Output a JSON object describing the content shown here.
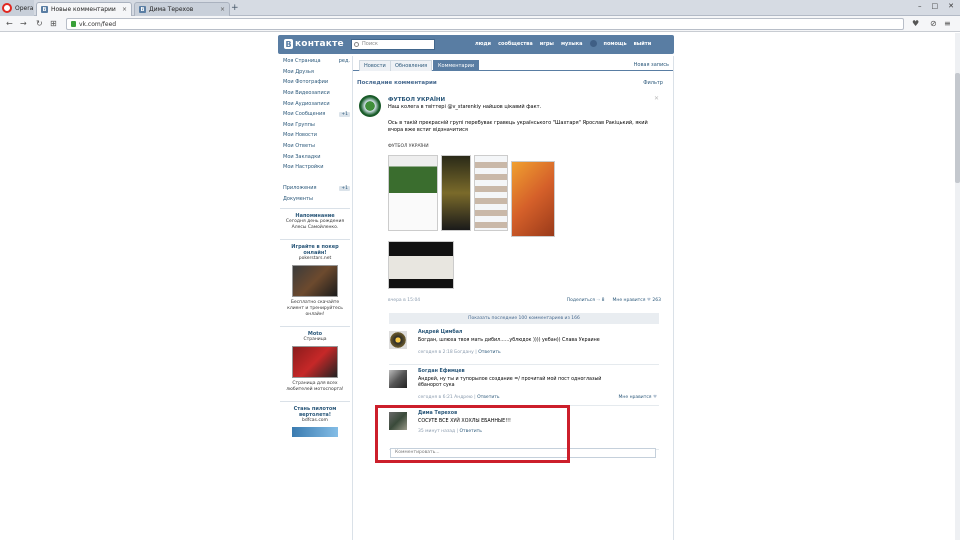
{
  "browser": {
    "menu_label": "Opera",
    "tabs": [
      {
        "title": "Новые комментарии",
        "favicon": "B",
        "active": true
      },
      {
        "title": "Дима Терехов",
        "favicon": "B",
        "active": false
      }
    ],
    "new_tab": "+",
    "address": "vk.com/feed"
  },
  "vk": {
    "logo_letter": "B",
    "logo_text": "контакте",
    "search_placeholder": "Поиск",
    "top_nav": [
      "люди",
      "сообщества",
      "игры",
      "музыка",
      "помощь",
      "выйти"
    ]
  },
  "left_menu": {
    "items": [
      {
        "label": "Моя Страница",
        "extra": "ред."
      },
      {
        "label": "Мои Друзья",
        "extra": ""
      },
      {
        "label": "Мои Фотографии",
        "extra": ""
      },
      {
        "label": "Мои Видеозаписи",
        "extra": ""
      },
      {
        "label": "Мои Аудиозаписи",
        "extra": ""
      },
      {
        "label": "Мои Сообщения",
        "extra": "+1"
      },
      {
        "label": "Мои Группы",
        "extra": ""
      },
      {
        "label": "Мои Новости",
        "extra": ""
      },
      {
        "label": "Мои Ответы",
        "extra": ""
      },
      {
        "label": "Мои Закладки",
        "extra": ""
      },
      {
        "label": "Мои Настройки",
        "extra": ""
      }
    ],
    "apps": {
      "label": "Приложения",
      "extra": "+1"
    },
    "docs": "Документы",
    "reminder": {
      "title": "Напоминание",
      "text": "Сегодня день рождения Алесы Самойленко."
    },
    "ad1": {
      "title": "Играйте в покер онлайн!",
      "site": "pokerstars.net",
      "text": "Бесплатно скачайте клиент и тренируйтесь онлайн!"
    },
    "ad2": {
      "title": "Moto",
      "sub": "Страница",
      "text": "Страница для всех любителей мотоспорта!"
    },
    "ad3": {
      "title": "Стань пилотом вертолета!",
      "site": "bdfcas.com"
    }
  },
  "feed": {
    "tabs": [
      "Новости",
      "Обновления",
      "Комментарии"
    ],
    "new_post": "Новая запись",
    "section_title": "Последние комментарии",
    "filter": "Фильтр",
    "post": {
      "author": "ФУТБОЛ УКРАЇНИ",
      "line1": "Наш колега в твіттері @v_starenkiy найшов цікавий факт.",
      "line2": "Ось в такій прекрасній групі перебуває гравець українського \"Шахтаря\" Ярослав Ракіцький, який вчора вже встиг відзначитися",
      "album_label": "ФУТБОЛ УКРАЇНИ",
      "date": "вчера в 15:04",
      "share": "Поделиться",
      "share_count": "8",
      "like": "Мне нравится",
      "like_count": "263"
    },
    "show_all": "Показать последние 100 комментариев из 166",
    "comments": [
      {
        "author": "Андрей Цимбал",
        "text": "Богдан, шлюха твоя мать дибил......ублюдок )))) уебан)) Слава Украине",
        "time": "сегодня в 2:18 Богдану",
        "reply": "Ответить",
        "like": ""
      },
      {
        "author": "Богдан Ефимцев",
        "text": "Андрей, ну ты и тупорылое создание =/ прочитай мой пост одноглазый ёбанорот сука",
        "time": "сегодня в 6:21 Андрею",
        "reply": "Ответить",
        "like": "Мне нравится"
      },
      {
        "author": "Дима Терехов",
        "text": "СОСУТЕ ВСЕ ХУЙ ХОХЛЫ ЕБАННЫЕ!!!",
        "time": "35 минут назад",
        "reply": "Ответить",
        "like": ""
      }
    ],
    "comment_placeholder": "Комментировать..."
  }
}
